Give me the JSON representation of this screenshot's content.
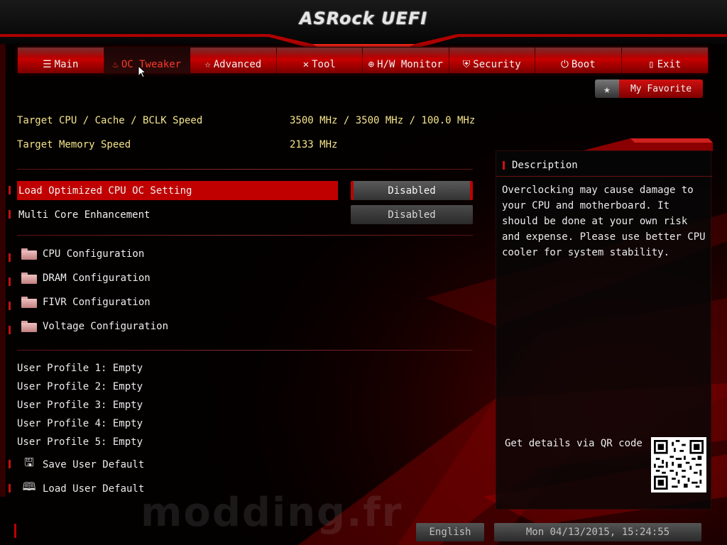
{
  "header": {
    "title": "ASRock UEFI"
  },
  "nav": {
    "tabs": [
      {
        "label": "Main",
        "icon": "list-icon"
      },
      {
        "label": "OC Tweaker",
        "icon": "flame-icon",
        "active": true
      },
      {
        "label": "Advanced",
        "icon": "star-outline-icon"
      },
      {
        "label": "Tool",
        "icon": "tools-icon"
      },
      {
        "label": "H/W Monitor",
        "icon": "monitor-icon"
      },
      {
        "label": "Security",
        "icon": "shield-icon"
      },
      {
        "label": "Boot",
        "icon": "power-icon"
      },
      {
        "label": "Exit",
        "icon": "exit-door-icon"
      }
    ]
  },
  "favorite": {
    "label": "My Favorite"
  },
  "info": {
    "cpu_label": "Target CPU / Cache / BCLK Speed",
    "cpu_value": "3500 MHz / 3500 MHz / 100.0 MHz",
    "mem_label": "Target Memory Speed",
    "mem_value": "2133 MHz"
  },
  "settings": [
    {
      "label": "Load Optimized CPU OC Setting",
      "value": "Disabled"
    },
    {
      "label": "Multi Core Enhancement",
      "value": "Disabled"
    }
  ],
  "submenus": [
    "CPU Configuration",
    "DRAM Configuration",
    "FIVR Configuration",
    "Voltage Configuration"
  ],
  "profiles": [
    "User Profile 1: Empty",
    "User Profile 2: Empty",
    "User Profile 3: Empty",
    "User Profile 4: Empty",
    "User Profile 5: Empty"
  ],
  "actions": {
    "save": "Save User Default",
    "load": "Load User Default"
  },
  "description": {
    "title": "Description",
    "text": "Overclocking may cause damage to your CPU and motherboard. It should be done at your own risk and expense. Please use better CPU cooler for system stability.",
    "qr_label": "Get details via QR code"
  },
  "footer": {
    "language": "English",
    "datetime": "Mon 04/13/2015, 15:24:55"
  },
  "watermark": "modding.fr",
  "colors": {
    "accent": "#c00000",
    "info_text": "#f5e58a"
  }
}
